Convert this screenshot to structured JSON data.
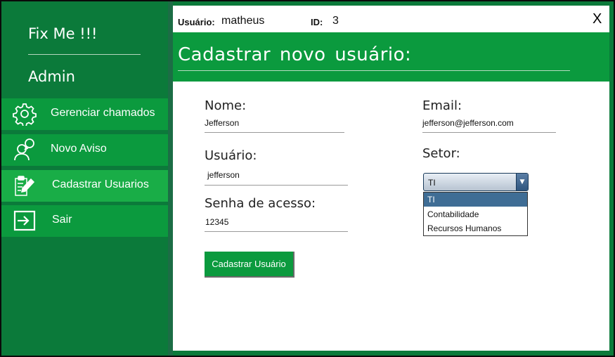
{
  "sidebar": {
    "brand": "Fix Me !!!",
    "role": "Admin",
    "items": [
      {
        "label": "Gerenciar chamados",
        "icon": "gear-icon"
      },
      {
        "label": "Novo Aviso",
        "icon": "person-bubble-icon"
      },
      {
        "label": "Cadastrar Usuarios",
        "icon": "clipboard-edit-icon",
        "active": true
      },
      {
        "label": "Sair",
        "icon": "exit-icon"
      }
    ]
  },
  "header": {
    "user_label": "Usuário:",
    "user_value": "matheus",
    "id_label": "ID:",
    "id_value": "3",
    "close_label": "X"
  },
  "banner": {
    "title": "Cadastrar novo usuário:"
  },
  "form": {
    "nome_label": "Nome:",
    "nome_value": "Jefferson",
    "email_label": "Email:",
    "email_value": "jefferson@jefferson.com",
    "usuario_label": "Usuário:",
    "usuario_value": "jefferson",
    "setor_label": "Setor:",
    "setor_selected": "TI",
    "setor_options": [
      "TI",
      "Contabilidade",
      "Recursos Humanos"
    ],
    "senha_label": "Senha de acesso:",
    "senha_value": "12345",
    "submit_label": "Cadastrar Usuário"
  },
  "colors": {
    "sidebar_bg": "#0b7a3a",
    "accent_green": "#0b9a3e",
    "active_item": "#19ad47",
    "dropdown_selected": "#3f6d95"
  }
}
